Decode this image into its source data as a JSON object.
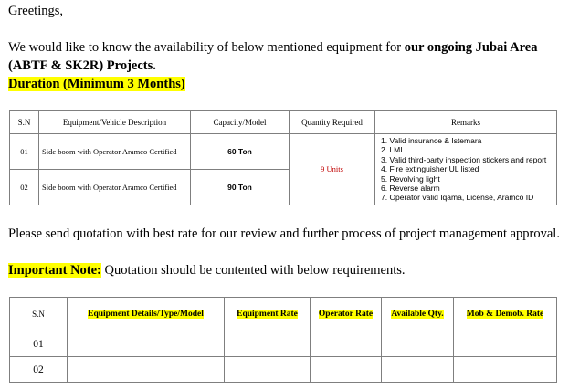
{
  "greeting": "Greetings,",
  "intro": {
    "text": "We would like to know the availability of below mentioned equipment for ",
    "bold1": "our ongoing Jubai Area",
    "bold2": "(ABTF & SK2R) Projects.",
    "duration": "Duration (Minimum 3 Months)"
  },
  "equipment_table": {
    "headers": [
      "S.N",
      "Equipment/Vehicle Description",
      "Capacity/Model",
      "Quantity Required",
      "Remarks"
    ],
    "rows": [
      {
        "sn": "01",
        "description": "Side boom with Operator Aramco Certified",
        "capacity": "60 Ton"
      },
      {
        "sn": "02",
        "description": "Side boom with Operator Aramco Certified",
        "capacity": "90 Ton"
      }
    ],
    "quantity": "9 Units",
    "remarks": [
      "1. Valid insurance & Istemara",
      "2. LMI",
      "3. Valid third-party inspection stickers and report",
      "4. Fire extinguisher UL listed",
      "5. Revolving light",
      "6. Reverse alarm",
      "7. Operator valid Iqama, License, Aramco ID"
    ]
  },
  "quotation_request": "Please send quotation with best rate for our review and further process of project management approval.",
  "important_note": {
    "label": "Important Note:",
    "text": " Quotation should be contented with below requirements."
  },
  "quote_table": {
    "headers": [
      "S.N",
      "Equipment Details/Type/Model",
      "Equipment Rate",
      "Operator Rate",
      "Available Qty.",
      "Mob & Demob. Rate"
    ],
    "rows": [
      "01",
      "02"
    ]
  },
  "colors": {
    "highlight": "#ffff00",
    "quantity_text": "#c00000",
    "border": "#7f7f7f"
  }
}
